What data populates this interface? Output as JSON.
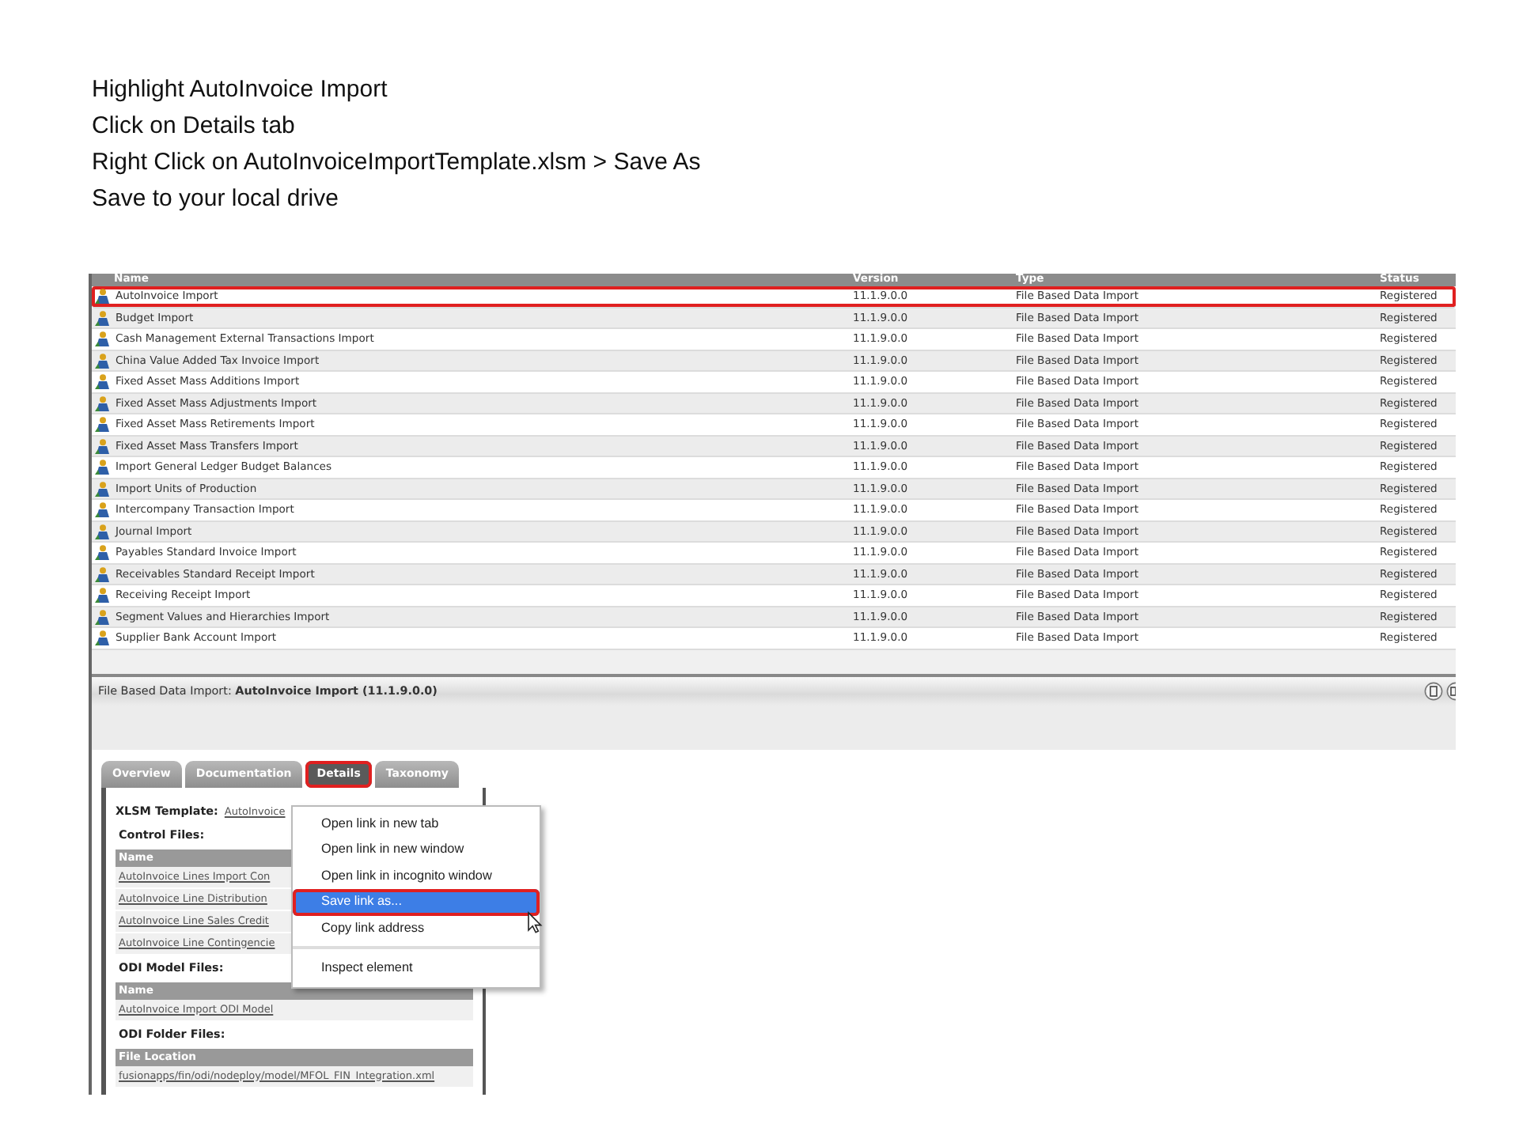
{
  "instructions": [
    "Highlight AutoInvoice Import",
    "Click on Details tab",
    "Right Click on AutoInvoiceImportTemplate.xlsm > Save As",
    "Save to your local drive"
  ],
  "table": {
    "columns": [
      "Name",
      "Version",
      "Type",
      "Status"
    ],
    "rows": [
      {
        "name": "AutoInvoice Import",
        "version": "11.1.9.0.0",
        "type": "File Based Data Import",
        "status": "Registered",
        "annotated": true
      },
      {
        "name": "Budget Import",
        "version": "11.1.9.0.0",
        "type": "File Based Data Import",
        "status": "Registered",
        "annotated": false
      },
      {
        "name": "Cash Management External Transactions Import",
        "version": "11.1.9.0.0",
        "type": "File Based Data Import",
        "status": "Registered",
        "annotated": false
      },
      {
        "name": "China Value Added Tax Invoice Import",
        "version": "11.1.9.0.0",
        "type": "File Based Data Import",
        "status": "Registered",
        "annotated": false
      },
      {
        "name": "Fixed Asset Mass Additions Import",
        "version": "11.1.9.0.0",
        "type": "File Based Data Import",
        "status": "Registered",
        "annotated": false
      },
      {
        "name": "Fixed Asset Mass Adjustments Import",
        "version": "11.1.9.0.0",
        "type": "File Based Data Import",
        "status": "Registered",
        "annotated": false
      },
      {
        "name": "Fixed Asset Mass Retirements Import",
        "version": "11.1.9.0.0",
        "type": "File Based Data Import",
        "status": "Registered",
        "annotated": false
      },
      {
        "name": "Fixed Asset Mass Transfers Import",
        "version": "11.1.9.0.0",
        "type": "File Based Data Import",
        "status": "Registered",
        "annotated": false
      },
      {
        "name": "Import General Ledger Budget Balances",
        "version": "11.1.9.0.0",
        "type": "File Based Data Import",
        "status": "Registered",
        "annotated": false
      },
      {
        "name": "Import Units of Production",
        "version": "11.1.9.0.0",
        "type": "File Based Data Import",
        "status": "Registered",
        "annotated": false
      },
      {
        "name": "Intercompany Transaction Import",
        "version": "11.1.9.0.0",
        "type": "File Based Data Import",
        "status": "Registered",
        "annotated": false
      },
      {
        "name": "Journal Import",
        "version": "11.1.9.0.0",
        "type": "File Based Data Import",
        "status": "Registered",
        "annotated": false
      },
      {
        "name": "Payables Standard Invoice Import",
        "version": "11.1.9.0.0",
        "type": "File Based Data Import",
        "status": "Registered",
        "annotated": false
      },
      {
        "name": "Receivables Standard Receipt Import",
        "version": "11.1.9.0.0",
        "type": "File Based Data Import",
        "status": "Registered",
        "annotated": false
      },
      {
        "name": "Receiving Receipt Import",
        "version": "11.1.9.0.0",
        "type": "File Based Data Import",
        "status": "Registered",
        "annotated": false
      },
      {
        "name": "Segment Values and Hierarchies Import",
        "version": "11.1.9.0.0",
        "type": "File Based Data Import",
        "status": "Registered",
        "annotated": false
      },
      {
        "name": "Supplier Bank Account Import",
        "version": "11.1.9.0.0",
        "type": "File Based Data Import",
        "status": "Registered",
        "annotated": false
      }
    ]
  },
  "detail": {
    "title": "File Based Data Import: **AutoInvoice Import (11.1.9.0.0)**",
    "tabs": [
      {
        "label": "Overview",
        "selected": false,
        "annotated": false
      },
      {
        "label": "Documentation",
        "selected": false,
        "annotated": false
      },
      {
        "label": "Details",
        "selected": true,
        "annotated": true
      },
      {
        "label": "Taxonomy",
        "selected": false,
        "annotated": false
      }
    ],
    "xlsm_label": "XLSM Template:",
    "xlsm_link": "AutoInvoice",
    "sections": [
      {
        "heading": "Control Files:",
        "column": "Name",
        "links": [
          "AutoInvoice Lines Import Con",
          "AutoInvoice Line Distribution",
          "AutoInvoice Line Sales Credit",
          "AutoInvoice Line Contingencie"
        ]
      },
      {
        "heading": "ODI Model Files:",
        "column": "Name",
        "links": [
          "AutoInvoice Import ODI Model"
        ]
      },
      {
        "heading": "ODI Folder Files:",
        "column": "File Location",
        "links": [
          "fusionapps/fin/odi/nodeploy/model/MFOL_FIN_Integration.xml"
        ]
      }
    ]
  },
  "context_menu": {
    "items": [
      {
        "label": "Open link in new tab",
        "selected": false,
        "annotated": false,
        "divider_before": false
      },
      {
        "label": "Open link in new window",
        "selected": false,
        "annotated": false,
        "divider_before": false
      },
      {
        "label": "Open link in incognito window",
        "selected": false,
        "annotated": false,
        "divider_before": false
      },
      {
        "label": "Save link as...",
        "selected": true,
        "annotated": true,
        "divider_before": false
      },
      {
        "label": "Copy link address",
        "selected": false,
        "annotated": false,
        "divider_before": false
      },
      {
        "label": "Inspect element",
        "selected": false,
        "annotated": false,
        "divider_before": true
      }
    ]
  }
}
